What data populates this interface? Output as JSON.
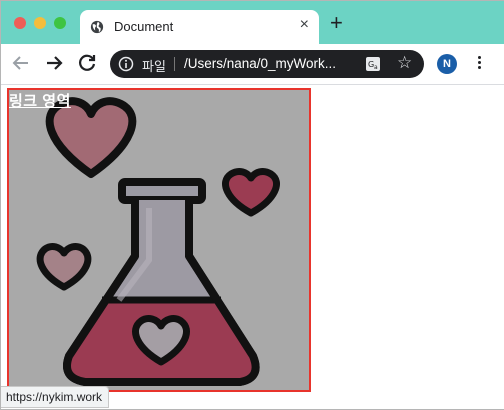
{
  "tab": {
    "title": "Document",
    "close_label": "×",
    "new_tab_label": "+"
  },
  "address": {
    "scheme_label": "파일",
    "url": "/Users/nana/0_myWork..."
  },
  "profile": {
    "initial": "N",
    "color": "#1a5ea8"
  },
  "page": {
    "link_text": "링크 영역"
  },
  "status_bar": {
    "url": "https://nykim.work"
  },
  "colors": {
    "tab_strip": "#6cd3c4",
    "link_border": "#e8342c",
    "overlay": "#a9a9a9",
    "heart": "#b3485e"
  },
  "icons": [
    "globe-icon",
    "back-arrow-icon",
    "forward-arrow-icon",
    "reload-icon",
    "info-icon",
    "translate-icon",
    "star-icon",
    "menu-kebab-icon",
    "flask-icon",
    "heart-icon"
  ]
}
